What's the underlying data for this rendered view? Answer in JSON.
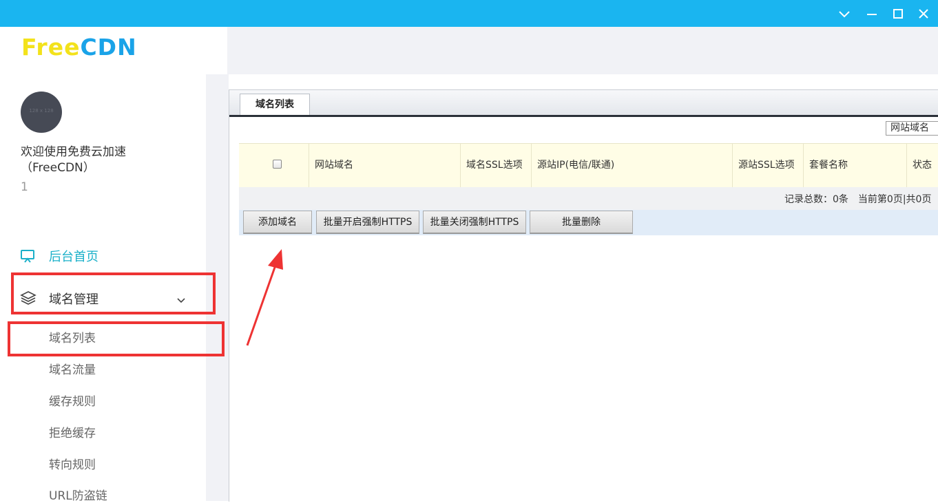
{
  "window": {
    "minimize_icon": "chevron-down-icon",
    "restore_icon": "minus-icon",
    "maximize_icon": "square-icon",
    "close_icon": "close-icon",
    "titlebar_color": "#1AB5F0"
  },
  "brand": {
    "logo_free": "Free",
    "logo_cdn": "CDN",
    "free_color": "#F3E21B",
    "cdn_color": "#1AA3E8"
  },
  "user": {
    "avatar_placeholder": "128 x 128",
    "welcome_line1": "欢迎使用免费云加速",
    "welcome_line2": "（FreeCDN）",
    "user_id": "1"
  },
  "sidebar": {
    "home": {
      "label": "后台首页",
      "icon": "monitor-icon",
      "color": "#1AB0C9"
    },
    "domain_mgmt": {
      "label": "域名管理",
      "icon": "layers-icon",
      "expand_icon": "chevron-down-icon"
    },
    "submenu": [
      "域名列表",
      "域名流量",
      "缓存规则",
      "拒绝缓存",
      "转向规则",
      "URL防盗链"
    ]
  },
  "main": {
    "tab_label": "域名列表",
    "search_field_selected": "网站域名",
    "table": {
      "headers": [
        "网站域名",
        "域名SSL选项",
        "源站IP(电信/联通)",
        "源站SSL选项",
        "套餐名称",
        "状态"
      ],
      "header_bg": "#FFFDE6"
    },
    "pager_text": "记录总数：0条　当前第0页|共0页",
    "buttons": [
      "添加域名",
      "批量开启强制HTTPS",
      "批量关闭强制HTTPS",
      "批量删除"
    ]
  },
  "annotation_color": "#EE3333"
}
